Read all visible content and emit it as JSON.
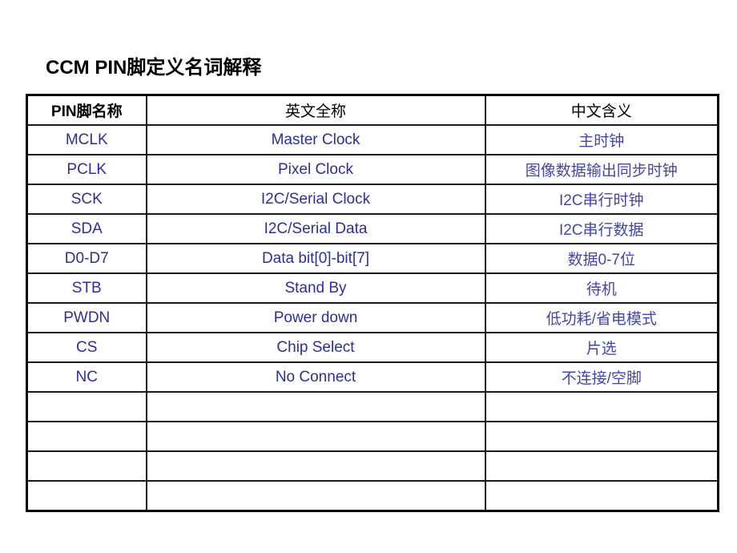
{
  "title": "CCM PIN脚定义名词解释",
  "table": {
    "headers": [
      "PIN脚名称",
      "英文全称",
      "中文含义"
    ],
    "rows": [
      [
        "MCLK",
        "Master Clock",
        "主时钟"
      ],
      [
        "PCLK",
        "Pixel Clock",
        "图像数据输出同步时钟"
      ],
      [
        "SCK",
        "I2C/Serial Clock",
        "I2C串行时钟"
      ],
      [
        "SDA",
        "I2C/Serial Data",
        "I2C串行数据"
      ],
      [
        "D0-D7",
        "Data bit[0]-bit[7]",
        "数据0-7位"
      ],
      [
        "STB",
        "Stand By",
        "待机"
      ],
      [
        "PWDN",
        "Power down",
        "低功耗/省电模式"
      ],
      [
        "CS",
        "Chip Select",
        "片选"
      ],
      [
        "NC",
        "No Connect",
        "不连接/空脚"
      ],
      [
        "",
        "",
        ""
      ],
      [
        "",
        "",
        ""
      ],
      [
        "",
        "",
        ""
      ],
      [
        "",
        "",
        ""
      ]
    ]
  },
  "colors": {
    "text_blue": "#2b2f9a",
    "border": "#1a1a1a"
  }
}
